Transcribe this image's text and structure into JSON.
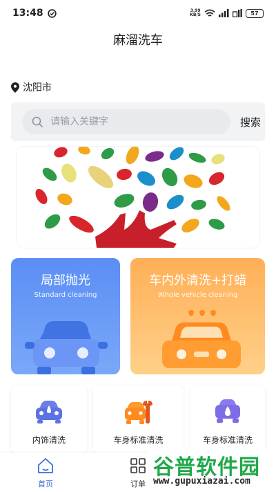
{
  "status_bar": {
    "time": "13:48",
    "net_speed_value": "3.99",
    "net_speed_unit": "KB/S",
    "battery": "57"
  },
  "header": {
    "title": "麻溜洗车"
  },
  "location": {
    "city": "沈阳市"
  },
  "search": {
    "placeholder": "请输入关键字",
    "button_label": "搜索"
  },
  "services": [
    {
      "title": "局部抛光",
      "subtitle": "Standard cleaning",
      "color": "#5b8ef5"
    },
    {
      "title": "车内外清洗+打蜡",
      "subtitle": "Whole vehicle cleaning",
      "color": "#ffb35c"
    }
  ],
  "mini_services": [
    {
      "label": "内饰清洗",
      "icon": "car-interior-icon"
    },
    {
      "label": "车身标准清洗",
      "icon": "car-repair-icon"
    },
    {
      "label": "车身标准清洗",
      "icon": "car-wash-icon"
    }
  ],
  "tabs": [
    {
      "label": "首页",
      "icon": "home-icon",
      "active": true
    },
    {
      "label": "订单",
      "icon": "order-grid-icon",
      "active": false
    }
  ],
  "watermark": {
    "text": "谷普软件园",
    "url": "www.gupuxiazai.com"
  },
  "colors": {
    "accent_blue": "#4a7ff0",
    "accent_orange": "#ffa64d",
    "active_tab": "#3a6fd8"
  }
}
